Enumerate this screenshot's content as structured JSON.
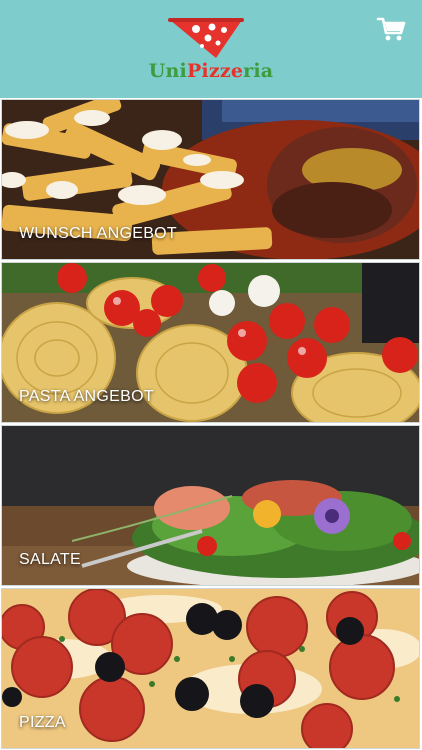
{
  "header": {
    "brand": {
      "part1": "Uni",
      "part2": "Pizze",
      "part3": "ria"
    },
    "cart_icon": "shopping-cart-icon",
    "background_color": "#7ecccc",
    "brand_green": "#3d9c3d",
    "brand_red": "#e5322d"
  },
  "categories": [
    {
      "label": "WUNSCH ANGEBOT",
      "image": "fries-and-sausage"
    },
    {
      "label": "PASTA ANGEBOT",
      "image": "pasta-and-tomatoes"
    },
    {
      "label": "SALATE",
      "image": "salad-plate"
    },
    {
      "label": "PIZZA",
      "image": "pepperoni-pizza"
    }
  ]
}
